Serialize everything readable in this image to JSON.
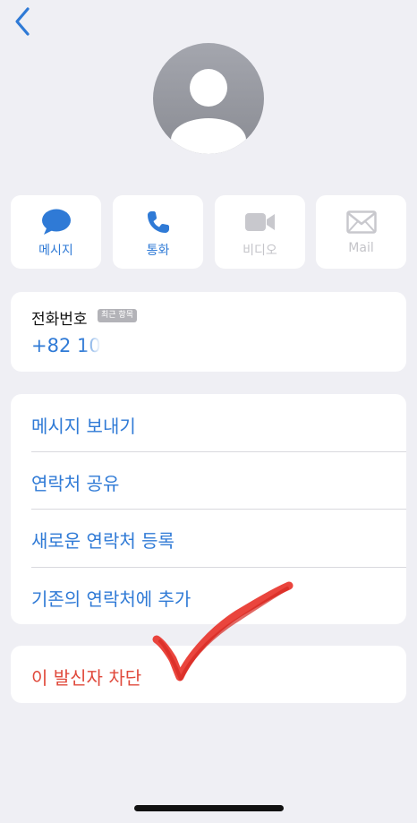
{
  "nav": {
    "back_icon": "chevron-left-icon"
  },
  "contact": {
    "avatar_icon": "person-silhouette-icon"
  },
  "actions": [
    {
      "label": "메시지",
      "icon": "message-bubble-icon",
      "enabled": true
    },
    {
      "label": "통화",
      "icon": "phone-icon",
      "enabled": true
    },
    {
      "label": "비디오",
      "icon": "video-camera-icon",
      "enabled": false
    },
    {
      "label": "Mail",
      "icon": "envelope-icon",
      "enabled": false
    }
  ],
  "phone": {
    "label": "전화번호",
    "badge": "최근 항목",
    "number": "+82 10"
  },
  "menu": {
    "items": [
      {
        "label": "메시지 보내기"
      },
      {
        "label": "연락처 공유"
      },
      {
        "label": "새로운 연락처 등록"
      },
      {
        "label": "기존의 연락처에 추가"
      }
    ]
  },
  "block": {
    "label": "이 발신자 차단"
  },
  "annotation": {
    "icon": "red-checkmark-icon"
  },
  "colors": {
    "background": "#efeff4",
    "accent": "#2f7ad6",
    "disabled": "#c4c4c9",
    "destructive": "#e0493b",
    "card": "#ffffff"
  }
}
